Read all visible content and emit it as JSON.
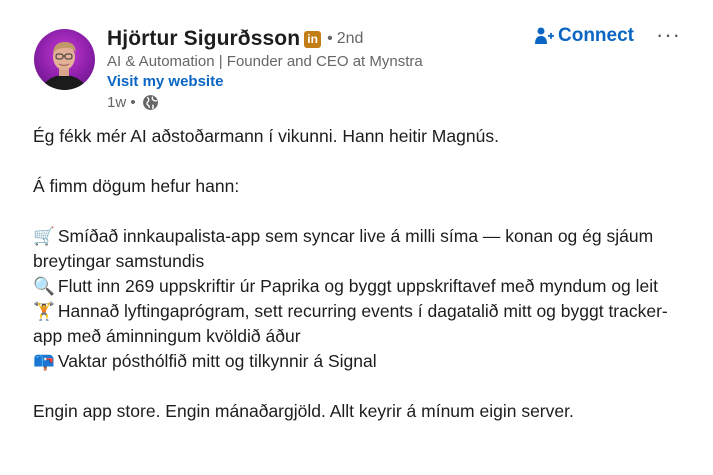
{
  "author": {
    "name": "Hjörtur Sigurðsson",
    "badge": "in",
    "degree": "2nd",
    "degree_separator": "•",
    "headline": "AI & Automation | Founder and CEO at Mynstra",
    "website_label": "Visit my website",
    "posted": "1w •"
  },
  "actions": {
    "connect_label": "Connect",
    "more_label": "···"
  },
  "post": {
    "line1": "Ég fékk mér AI aðstoðarmann í vikunni. Hann heitir Magnús.",
    "line2": "Á fimm dögum hefur hann:",
    "items": [
      {
        "emoji": "🛒",
        "text": "Smíðað innkaupalista-app sem syncar live á milli síma — konan og ég sjáum breytingar samstundis"
      },
      {
        "emoji": "🔍",
        "text": "Flutt inn 269 uppskriftir úr Paprika og byggt uppskriftavef með myndum og leit"
      },
      {
        "emoji": "🏋",
        "text": "Hannað lyftingaprógram, sett recurring events í dagatalið mitt og byggt tracker-app með áminningum kvöldið áður"
      },
      {
        "emoji": "📪",
        "text": "Vaktar pósthólfið mitt og tilkynnir á Signal"
      }
    ],
    "line3": "Engin app store. Engin mánaðargjöld. Allt keyrir á mínum eigin server."
  },
  "colors": {
    "link": "#0a66c2",
    "secondary_text": "#666666",
    "badge": "#c37d16"
  },
  "icons": {
    "connect": "person-add-icon",
    "visibility": "globe-icon"
  }
}
